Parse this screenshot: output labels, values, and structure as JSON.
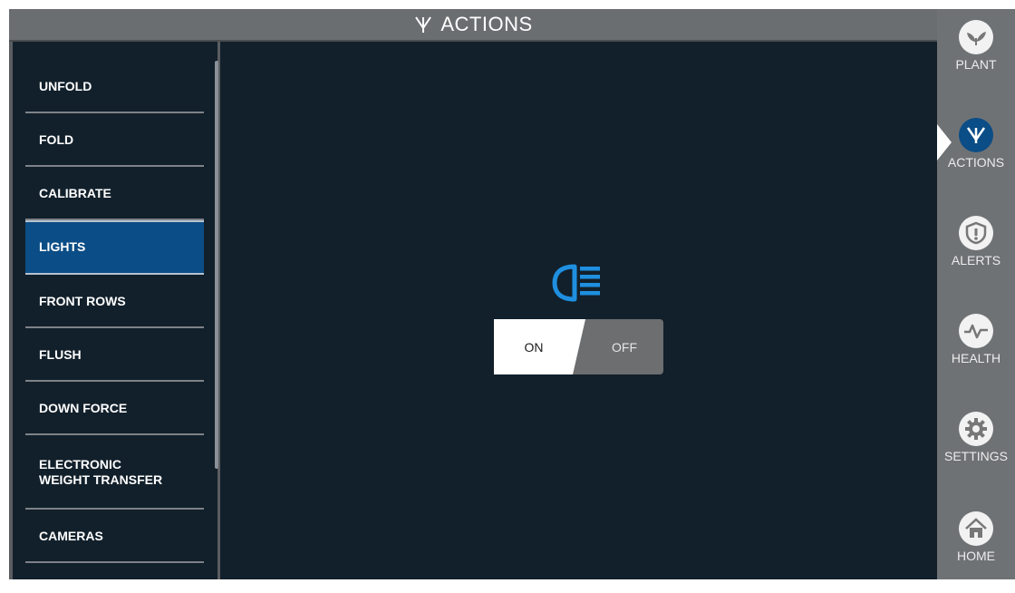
{
  "header": {
    "title": "ACTIONS",
    "icon": "actions-icon"
  },
  "menu": {
    "items": [
      {
        "label": "UNFOLD"
      },
      {
        "label": "FOLD"
      },
      {
        "label": "CALIBRATE"
      },
      {
        "label": "LIGHTS",
        "active": true
      },
      {
        "label": "FRONT ROWS"
      },
      {
        "label": "FLUSH"
      },
      {
        "label": "DOWN FORCE"
      },
      {
        "label": "ELECTRONIC\nWEIGHT TRANSFER"
      },
      {
        "label": "CAMERAS"
      }
    ]
  },
  "lights": {
    "icon": "headlight-icon",
    "toggle": {
      "on_label": "ON",
      "off_label": "OFF",
      "selected": "ON"
    }
  },
  "sidebar": {
    "items": [
      {
        "label": "PLANT",
        "icon": "plant-icon"
      },
      {
        "label": "ACTIONS",
        "icon": "actions-icon",
        "active": true
      },
      {
        "label": "ALERTS",
        "icon": "alert-shield-icon"
      },
      {
        "label": "HEALTH",
        "icon": "heartbeat-icon"
      },
      {
        "label": "SETTINGS",
        "icon": "gear-icon"
      },
      {
        "label": "HOME",
        "icon": "home-icon"
      }
    ]
  },
  "colors": {
    "panel_bg": "#12202b",
    "accent_blue": "#0b4d86",
    "icon_blue": "#1f8fe0",
    "chrome_gray": "#6f7275"
  }
}
